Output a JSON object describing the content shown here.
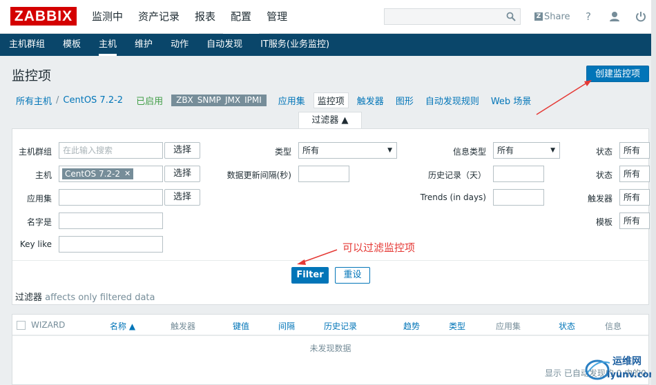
{
  "header": {
    "logo": "ZABBIX",
    "nav": [
      "监测中",
      "资产记录",
      "报表",
      "配置",
      "管理"
    ],
    "active_nav": 3,
    "share_label": "Share",
    "share_logo": "Z",
    "help": "?"
  },
  "subnav": {
    "items": [
      "主机群组",
      "模板",
      "主机",
      "维护",
      "动作",
      "自动发现",
      "IT服务(业务监控)"
    ],
    "active": 2
  },
  "page": {
    "title": "监控项",
    "create_button": "创建监控项"
  },
  "breadcrumbs": {
    "all_hosts": "所有主机",
    "separator": "/",
    "host": "CentOS 7.2-2",
    "status": "已启用",
    "tags": [
      "ZBX",
      "SNMP",
      "JMX",
      "IPMI"
    ],
    "tabs": [
      "应用集",
      "监控项",
      "触发器",
      "图形",
      "自动发现规则",
      "Web 场景"
    ],
    "active_tab": 1
  },
  "filter": {
    "tab_label": "过滤器 ▲",
    "host_group_label": "主机群组",
    "host_group_placeholder": "在此输入搜索",
    "select_label": "选择",
    "host_label": "主机",
    "host_chip": "CentOS 7.2-2",
    "application_label": "应用集",
    "name_label": "名字是",
    "key_label": "Key like",
    "type_label": "类型",
    "type_value": "所有",
    "interval_label": "数据更新间隔(秒)",
    "info_type_label": "信息类型",
    "info_type_value": "所有",
    "history_label": "历史记录（天）",
    "trends_label": "Trends (in days)",
    "state_label": "状态",
    "state_value": "所有",
    "status_label": "状态",
    "status_value": "所有",
    "triggers_label": "触发器",
    "triggers_value": "所有",
    "template_label": "模板",
    "template_value": "所有",
    "filter_button": "Filter",
    "reset_button": "重设",
    "note_bold": "过滤器",
    "note_rest": "affects only filtered data"
  },
  "table": {
    "columns": [
      "WIZARD",
      "名称 ▲",
      "触发器",
      "键值",
      "间隔",
      "历史记录",
      "趋势",
      "类型",
      "应用集",
      "状态",
      "信息"
    ],
    "empty_text": "未发现数据",
    "footer": "显示 已自动发现的 0 中的0"
  },
  "annotation": {
    "text": "可以过滤监控项",
    "color": "#e53935"
  },
  "watermark": {
    "text": "运维网",
    "sub": "iyunv.com"
  },
  "colors": {
    "brand_red": "#d40000",
    "nav_dark": "#0a466a",
    "link_blue": "#0275b8",
    "enabled_green": "#429e47"
  }
}
